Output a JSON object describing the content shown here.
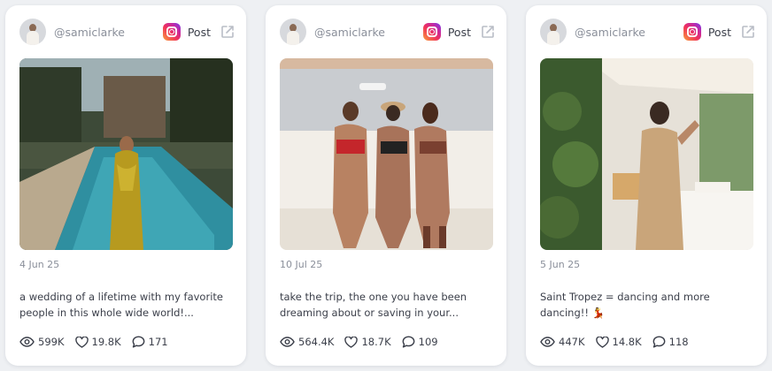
{
  "post_button_label": "Post",
  "colors": {
    "card_bg": "#ffffff",
    "page_bg": "#eef0f3",
    "muted_text": "#8a8f9a"
  },
  "icons": [
    "instagram-icon",
    "external-link-icon",
    "eye-icon",
    "heart-icon",
    "comment-icon"
  ],
  "cards": [
    {
      "handle": "@samiclarke",
      "date": "4 Jun 25",
      "caption": "a wedding of a lifetime with my favorite people in this whole wide world!...",
      "views": "599K",
      "likes": "19.8K",
      "comments": "171"
    },
    {
      "handle": "@samiclarke",
      "date": "10 Jul 25",
      "caption": "take the trip, the one you have been dreaming about or saving in your...",
      "views": "564.4K",
      "likes": "18.7K",
      "comments": "109"
    },
    {
      "handle": "@samiclarke",
      "date": "5 Jun 25",
      "caption": "Saint Tropez = dancing and more dancing!! 💃",
      "views": "447K",
      "likes": "14.8K",
      "comments": "118"
    }
  ]
}
